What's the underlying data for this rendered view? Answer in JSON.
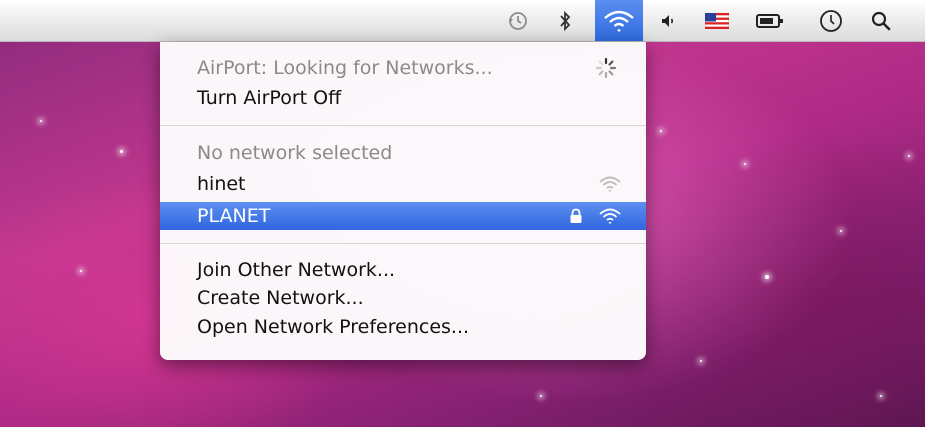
{
  "menubar": {
    "icons": [
      "time-machine-icon",
      "bluetooth-icon",
      "airport-wifi-icon",
      "volume-icon",
      "us-flag-input-icon",
      "battery-icon",
      "clock-icon",
      "spotlight-search-icon"
    ]
  },
  "airport_menu": {
    "status": "AirPort: Looking for Networks...",
    "turn_off": "Turn AirPort Off",
    "no_network": "No network selected",
    "networks": [
      {
        "name": "hinet",
        "secured": false,
        "selected": false
      },
      {
        "name": "PLANET",
        "secured": true,
        "selected": true
      }
    ],
    "join_other": "Join Other Network...",
    "create": "Create Network...",
    "open_prefs": "Open Network Preferences..."
  },
  "colors": {
    "highlight": "#3A72E5",
    "disabled_text": "#8A8A8A"
  }
}
